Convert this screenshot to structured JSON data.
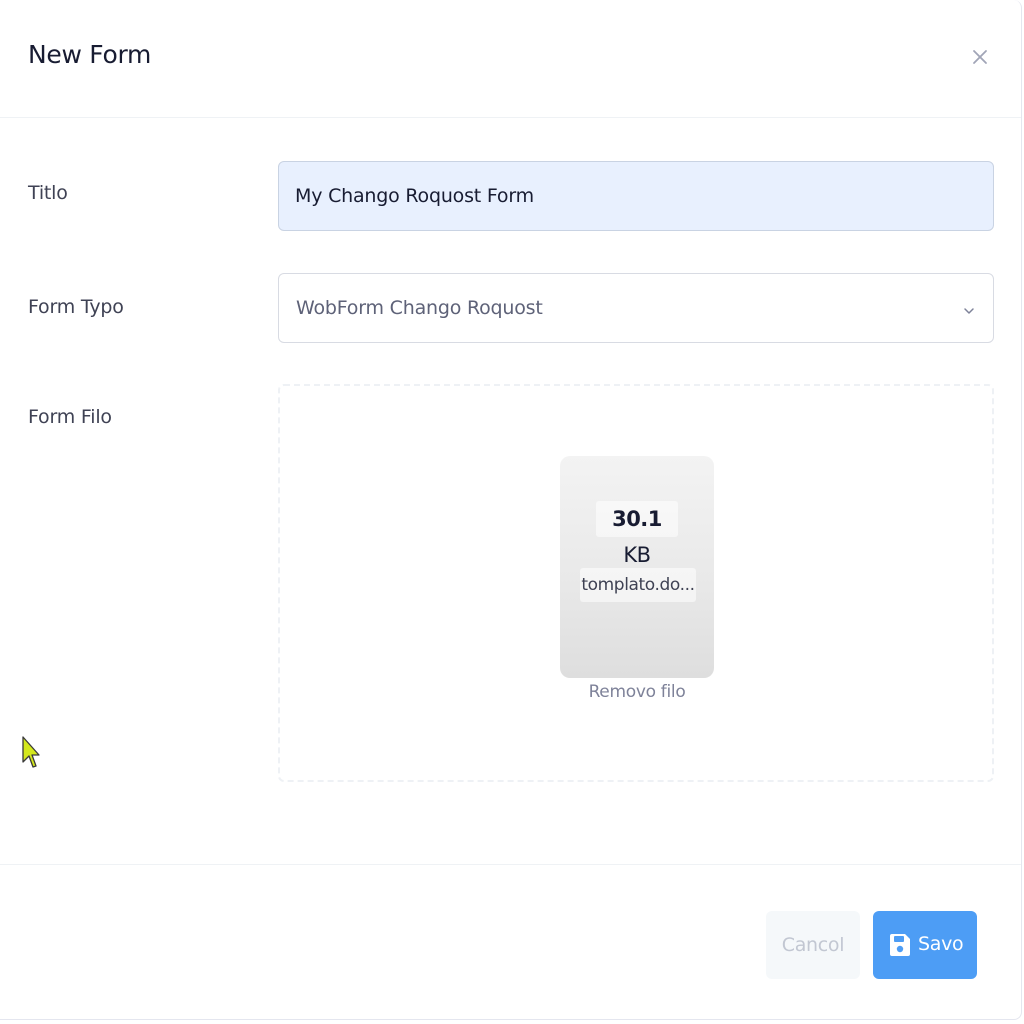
{
  "modal": {
    "title": "New Form",
    "close_icon": "close-icon"
  },
  "fields": {
    "title_label": "Titlo",
    "title_value": "My Chango Roquost Form",
    "type_label": "Form Typo",
    "type_value": "WobForm Chango Roquost",
    "file_label": "Form Filo"
  },
  "file": {
    "size_number": "30.1",
    "size_unit": "KB",
    "name": "tomplato.do...",
    "remove_label": "Removo filo"
  },
  "footer": {
    "cancel_label": "Cancol",
    "save_label": "Savo",
    "save_icon": "floppy-disk-icon"
  },
  "colors": {
    "primary": "#4d9df5",
    "input_autofill_bg": "#e8f0fe",
    "cancel_bg": "#f5f8fa",
    "cursor": "#d4e81c"
  }
}
